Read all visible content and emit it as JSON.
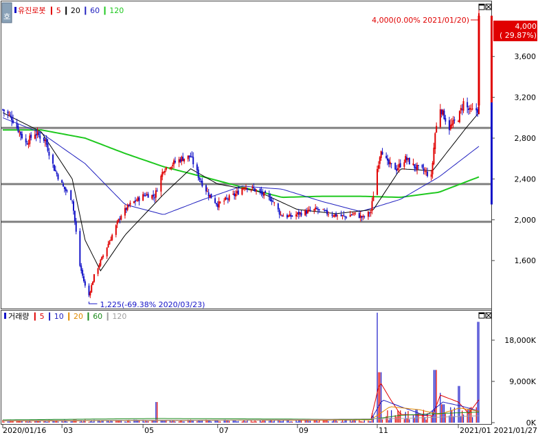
{
  "price_pane": {
    "title": "유진로봇",
    "legend": [
      {
        "label": "5",
        "color": "#e00000"
      },
      {
        "label": "20",
        "color": "#000000"
      },
      {
        "label": "60",
        "color": "#1f1fbf"
      },
      {
        "label": "120",
        "color": "#1ec81e"
      }
    ],
    "y_ticks": [
      "3,600",
      "3,200",
      "2,800",
      "2,400",
      "2,000",
      "1,600"
    ],
    "high_label": "4,000(0.00% 2021/01/20)",
    "low_label": "1,225(-69.38% 2020/03/23)",
    "current_box": {
      "value": "4,000",
      "change": "( 29.87%)"
    }
  },
  "volume_pane": {
    "title": "거래량",
    "legend": [
      {
        "label": "5",
        "color": "#e00000"
      },
      {
        "label": "10",
        "color": "#1f1fbf"
      },
      {
        "label": "20",
        "color": "#e08a00"
      },
      {
        "label": "60",
        "color": "#1a8a1a"
      },
      {
        "label": "120",
        "color": "#a0a0a0"
      }
    ],
    "y_ticks": [
      "18,000K",
      "9,000K",
      "0K"
    ]
  },
  "x_axis": {
    "labels": [
      "2020/01/16",
      "03",
      "05",
      "07",
      "09",
      "11",
      "2021/01"
    ],
    "end_label": "2021/01/27"
  },
  "colors": {
    "up": "#e00000",
    "down": "#1414c8",
    "support": "#808080"
  },
  "chart_data": {
    "type": "candlestick",
    "title": "유진로봇",
    "x_range": [
      "2020/01/16",
      "2021/01/27"
    ],
    "ylim": [
      1150,
      4100
    ],
    "y_ticks": [
      1600,
      2000,
      2400,
      2800,
      3200,
      3600
    ],
    "grid": false,
    "horizontal_lines": [
      2900,
      2350,
      1980
    ],
    "annotations": [
      {
        "text": "4,000(0.00% 2021/01/20)",
        "date": "2021/01/20",
        "value": 4000
      },
      {
        "text": "1,225(-69.38% 2020/03/23)",
        "date": "2020/03/23",
        "value": 1225
      }
    ],
    "close_anchors": [
      [
        "2020/01/16",
        3080
      ],
      [
        "2020/01/23",
        3000
      ],
      [
        "2020/02/03",
        2750
      ],
      [
        "2020/02/10",
        2850
      ],
      [
        "2020/02/18",
        2780
      ],
      [
        "2020/02/25",
        2500
      ],
      [
        "2020/03/03",
        2320
      ],
      [
        "2020/03/10",
        2200
      ],
      [
        "2020/03/16",
        1550
      ],
      [
        "2020/03/20",
        1350
      ],
      [
        "2020/03/23",
        1260
      ],
      [
        "2020/03/27",
        1450
      ],
      [
        "2020/04/03",
        1650
      ],
      [
        "2020/04/10",
        1850
      ],
      [
        "2020/04/17",
        2050
      ],
      [
        "2020/04/24",
        2150
      ],
      [
        "2020/05/06",
        2250
      ],
      [
        "2020/05/13",
        2230
      ],
      [
        "2020/05/20",
        2500
      ],
      [
        "2020/05/27",
        2550
      ],
      [
        "2020/06/03",
        2600
      ],
      [
        "2020/06/10",
        2620
      ],
      [
        "2020/06/17",
        2400
      ],
      [
        "2020/06/24",
        2250
      ],
      [
        "2020/07/01",
        2150
      ],
      [
        "2020/07/08",
        2200
      ],
      [
        "2020/07/15",
        2250
      ],
      [
        "2020/07/22",
        2330
      ],
      [
        "2020/07/29",
        2300
      ],
      [
        "2020/08/05",
        2250
      ],
      [
        "2020/08/12",
        2200
      ],
      [
        "2020/08/19",
        2050
      ],
      [
        "2020/08/26",
        2030
      ],
      [
        "2020/09/02",
        2060
      ],
      [
        "2020/09/09",
        2080
      ],
      [
        "2020/09/16",
        2100
      ],
      [
        "2020/09/23",
        2070
      ],
      [
        "2020/09/29",
        2050
      ],
      [
        "2020/10/08",
        2030
      ],
      [
        "2020/10/15",
        2060
      ],
      [
        "2020/10/22",
        2020
      ],
      [
        "2020/10/28",
        2080
      ],
      [
        "2020/11/02",
        2500
      ],
      [
        "2020/11/05",
        2700
      ],
      [
        "2020/11/10",
        2550
      ],
      [
        "2020/11/17",
        2500
      ],
      [
        "2020/11/24",
        2600
      ],
      [
        "2020/12/01",
        2520
      ],
      [
        "2020/12/08",
        2480
      ],
      [
        "2020/12/14",
        2420
      ],
      [
        "2020/12/17",
        2850
      ],
      [
        "2020/12/21",
        3100
      ],
      [
        "2020/12/28",
        2900
      ],
      [
        "2021/01/04",
        3000
      ],
      [
        "2021/01/08",
        3150
      ],
      [
        "2021/01/13",
        3060
      ],
      [
        "2021/01/19",
        3080
      ],
      [
        "2021/01/20",
        4000
      ],
      [
        "2021/01/21",
        3500
      ],
      [
        "2021/01/27",
        3500
      ]
    ],
    "ma_anchors": {
      "ma20": [
        [
          "2020/01/16",
          3050
        ],
        [
          "2020/02/15",
          2860
        ],
        [
          "2020/03/10",
          2400
        ],
        [
          "2020/03/20",
          1800
        ],
        [
          "2020/04/01",
          1500
        ],
        [
          "2020/04/20",
          1850
        ],
        [
          "2020/05/20",
          2250
        ],
        [
          "2020/06/10",
          2500
        ],
        [
          "2020/07/01",
          2350
        ],
        [
          "2020/08/01",
          2280
        ],
        [
          "2020/09/01",
          2100
        ],
        [
          "2020/10/01",
          2060
        ],
        [
          "2020/10/30",
          2100
        ],
        [
          "2020/11/20",
          2500
        ],
        [
          "2020/12/15",
          2480
        ],
        [
          "2021/01/10",
          2900
        ],
        [
          "2021/01/20",
          3050
        ]
      ],
      "ma60": [
        [
          "2020/01/16",
          3000
        ],
        [
          "2020/02/15",
          2850
        ],
        [
          "2020/03/20",
          2550
        ],
        [
          "2020/04/20",
          2150
        ],
        [
          "2020/05/20",
          2050
        ],
        [
          "2020/06/20",
          2200
        ],
        [
          "2020/07/20",
          2330
        ],
        [
          "2020/08/20",
          2300
        ],
        [
          "2020/09/20",
          2180
        ],
        [
          "2020/10/20",
          2080
        ],
        [
          "2020/11/20",
          2200
        ],
        [
          "2020/12/20",
          2420
        ],
        [
          "2021/01/20",
          2720
        ]
      ],
      "ma120": [
        [
          "2020/01/16",
          2880
        ],
        [
          "2020/02/15",
          2880
        ],
        [
          "2020/03/20",
          2800
        ],
        [
          "2020/04/20",
          2650
        ],
        [
          "2020/05/20",
          2520
        ],
        [
          "2020/06/20",
          2420
        ],
        [
          "2020/07/20",
          2320
        ],
        [
          "2020/08/20",
          2220
        ],
        [
          "2020/09/20",
          2230
        ],
        [
          "2020/10/20",
          2230
        ],
        [
          "2020/11/20",
          2220
        ],
        [
          "2020/12/20",
          2270
        ],
        [
          "2021/01/20",
          2420
        ]
      ]
    },
    "volume": {
      "unit": "K",
      "ylim": [
        0,
        24000
      ],
      "y_ticks": [
        0,
        9000,
        18000
      ],
      "spikes": [
        [
          "2020/05/15",
          4500
        ],
        [
          "2020/11/02",
          26000
        ],
        [
          "2020/11/04",
          11000
        ],
        [
          "2020/12/17",
          11500
        ],
        [
          "2020/12/21",
          6500
        ],
        [
          "2020/12/23",
          4000
        ],
        [
          "2021/01/04",
          8000
        ],
        [
          "2021/01/20",
          22000
        ]
      ],
      "ma5_peak": [
        [
          "2020/11/06",
          9000
        ]
      ]
    }
  }
}
